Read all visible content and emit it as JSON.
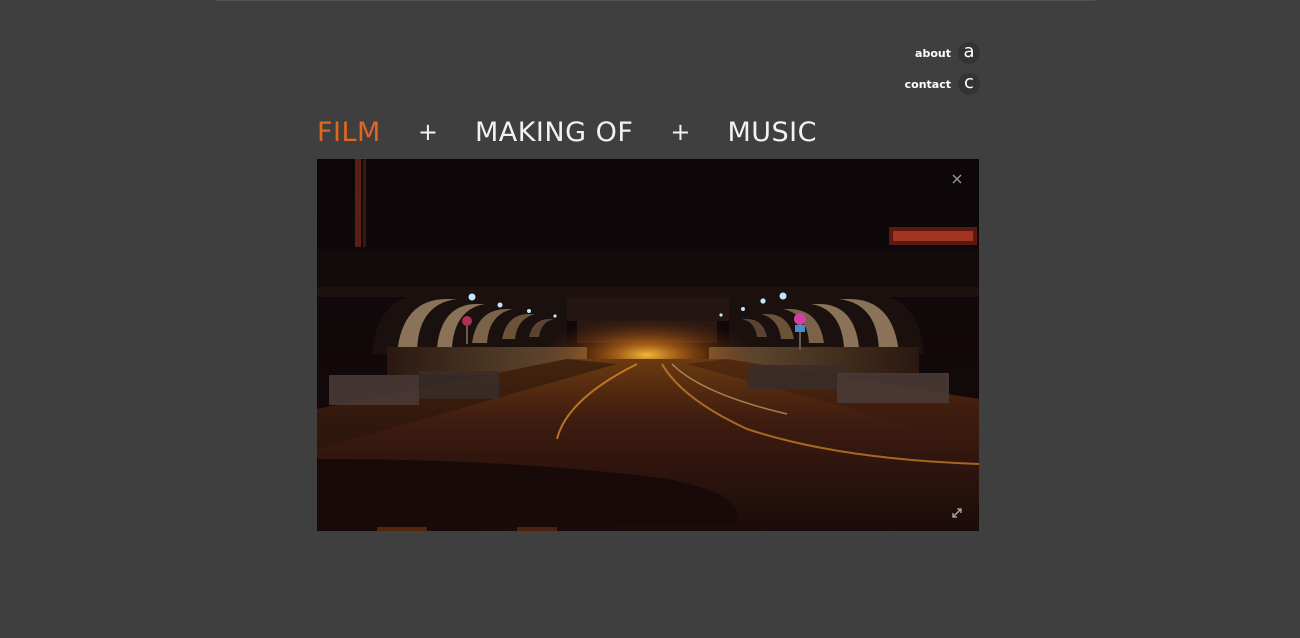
{
  "quick_links": [
    {
      "label": "about",
      "glyph": "a"
    },
    {
      "label": "contact",
      "glyph": "c"
    }
  ],
  "nav": {
    "items": [
      "FILM",
      "MAKING OF",
      "MUSIC"
    ],
    "separator": "+",
    "active": "FILM"
  },
  "video": {
    "close_icon": "close-icon",
    "fullscreen_icon": "fullscreen-icon"
  },
  "colors": {
    "background": "#3f3f3f",
    "accent": "#e2661c",
    "nav_text": "#f2f2f2"
  }
}
